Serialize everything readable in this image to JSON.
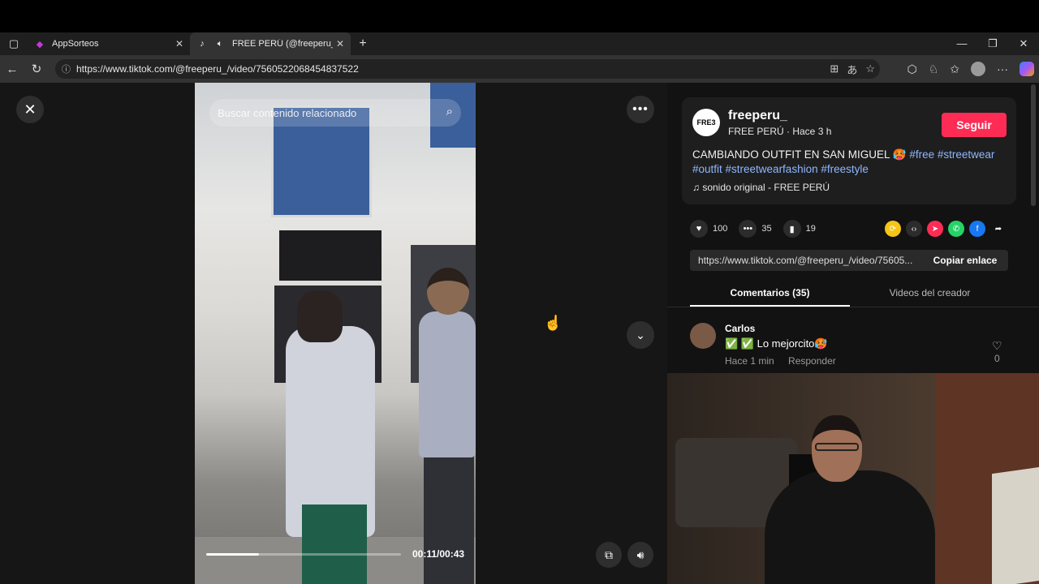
{
  "browser": {
    "tabs": [
      {
        "label": "AppSorteos",
        "icon": "appsorteos-icon"
      },
      {
        "label": "FREE PERÚ (@freeperu_) | Ti",
        "icon": "tiktok-icon"
      }
    ],
    "url": "https://www.tiktok.com/@freeperu_/video/7560522068454837522"
  },
  "player": {
    "search_placeholder": "Buscar contenido relacionado",
    "time": "00:11/00:43",
    "progress": 0.27
  },
  "post": {
    "avatar_text": "FRE3",
    "author": "freeperu_",
    "subtitle": "FREE PERÚ · Hace 3 h",
    "follow_label": "Seguir",
    "caption_text": "CAMBIANDO OUTFIT EN SAN MIGUEL 🥵 ",
    "hashtags_line1": "#free #streetwear",
    "hashtags_line2": "#outfit #streetwearfashion #freestyle",
    "music": "♫  sonido original - FREE PERÚ",
    "likes": "100",
    "comments": "35",
    "saves": "19",
    "share_link": "https://www.tiktok.com/@freeperu_/video/75605...",
    "copy_label": "Copiar enlace",
    "tabs": [
      "Comentarios (35)",
      "Videos del creador"
    ]
  },
  "comment": {
    "name": "Carlos",
    "text": "✅ ✅ Lo mejorcito🥵",
    "time": "Hace 1 min",
    "reply": "Responder",
    "likes": "0"
  },
  "colors": {
    "follow": "#fe2c55",
    "hashtag": "#8fb7ff"
  }
}
